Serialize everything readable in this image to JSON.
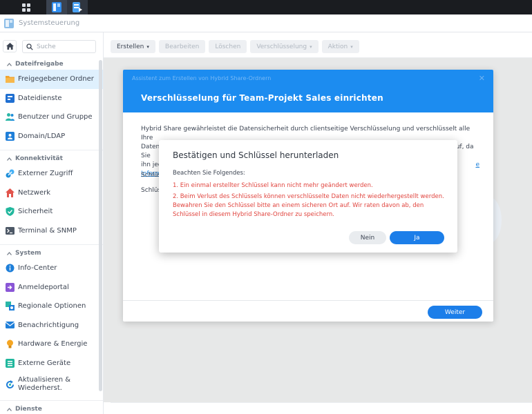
{
  "window": {
    "title": "Systemsteuerung"
  },
  "sidebar": {
    "search_placeholder": "Suche",
    "sections": [
      {
        "label": "Dateifreigabe",
        "items": [
          "Freigegebener Ordner",
          "Dateidienste",
          "Benutzer und Gruppe",
          "Domain/LDAP"
        ]
      },
      {
        "label": "Konnektivität",
        "items": [
          "Externer Zugriff",
          "Netzwerk",
          "Sicherheit",
          "Terminal & SNMP"
        ]
      },
      {
        "label": "System",
        "items": [
          "Info-Center",
          "Anmeldeportal",
          "Regionale Optionen",
          "Benachrichtigung",
          "Hardware & Energie",
          "Externe Geräte",
          "Aktualisieren &",
          "Wiederherst."
        ]
      },
      {
        "label": "Dienste"
      }
    ],
    "active_item": "Freigegebener Ordner"
  },
  "toolbar": {
    "create": "Erstellen",
    "edit": "Bearbeiten",
    "delete": "Löschen",
    "encryption": "Verschlüsselung",
    "action": "Aktion"
  },
  "wizard": {
    "subtitle": "Assistent zum Erstellen von Hybrid Share-Ordnern",
    "title": "Verschlüsselung für Team-Projekt Sales einrichten",
    "body_line1": "Hybrid Share gewährleistet die Datensicherheit durch clientseitige Verschlüsselung und verschlüsselt alle Ihre",
    "body_line2_start": "Daten lokal, bevor sie zu C2 Storage hochgeladen werden. Bewahren Sie den Schlüssel bitte sicher auf, da Sie",
    "body_line3_start": "ihn jed",
    "body_line3_end": "e",
    "body_link": "Inform",
    "label1": "Schlüs",
    "label2": "Schlüs",
    "next_button": "Weiter"
  },
  "confirm": {
    "title": "Bestätigen und Schlüssel herunterladen",
    "intro": "Beachten Sie Folgendes:",
    "point1": "1. Ein einmal erstellter Schlüssel kann nicht mehr geändert werden.",
    "point2": "2. Beim Verlust des Schlüssels können verschlüsselte Daten nicht wiederhergestellt werden. Bewahren Sie den Schlüssel bitte an einem sicheren Ort auf. Wir raten davon ab, den Schlüssel in diesem Hybrid Share-Ordner zu speichern.",
    "no": "Nein",
    "yes": "Ja"
  }
}
